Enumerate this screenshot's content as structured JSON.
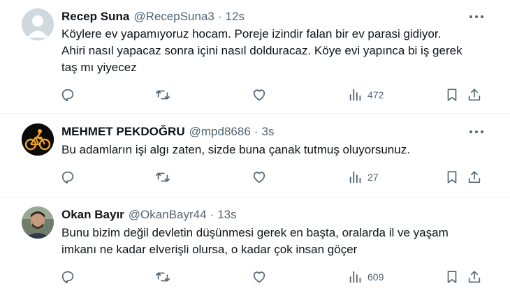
{
  "tweets": [
    {
      "name": "Recep Suna",
      "handle": "@RecepSuna3",
      "sep": "·",
      "time": "12s",
      "lines": [
        "Köylere ev yapamıyoruz hocam. Poreje izindir falan bir ev parasi gidiyor.",
        "Ahiri nasıl yapacaz sonra içini nasıl dolduracaz. Köye evi yapınca bi iş gerek",
        "taş mı yiyecez"
      ],
      "views": "472",
      "avatar_icon": "default-person-avatar"
    },
    {
      "name": "MEHMET PEKDOĞRU",
      "handle": "@mpd8686",
      "sep": "·",
      "time": "3s",
      "lines": [
        "Bu adamların işi algı zaten, sizde buna çanak tutmuş oluyorsunuz."
      ],
      "views": "27",
      "avatar_icon": "cyclist-logo-avatar"
    },
    {
      "name": "Okan Bayır",
      "handle": "@OkanBayr44",
      "sep": "·",
      "time": "13s",
      "lines": [
        "Bunu bizim değil devletin düşünmesi gerek en başta, oralarda il ve yaşam",
        "imkanı ne kadar elverişli olursa, o kadar çok insan göçer"
      ],
      "views": "609",
      "avatar_icon": "photo-avatar"
    }
  ],
  "colors": {
    "text": "#0f1419",
    "secondary": "#536471",
    "divider": "#eff3f4",
    "logo_orange": "#f5a623"
  },
  "icons": [
    "reply-icon",
    "retweet-icon",
    "like-icon",
    "views-icon",
    "bookmark-icon",
    "share-icon",
    "more-icon"
  ]
}
